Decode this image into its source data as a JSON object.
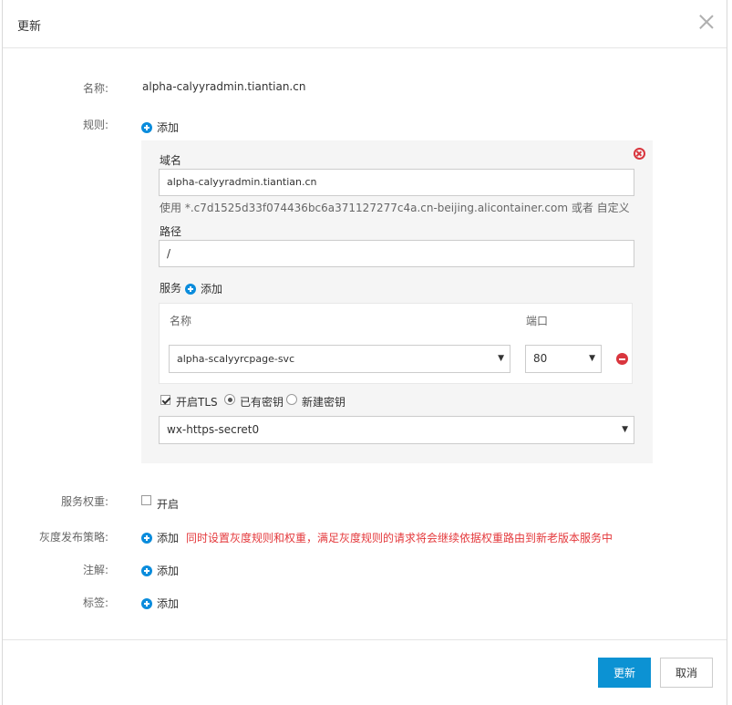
{
  "dialog": {
    "title": "更新",
    "name_label": "名称:",
    "name_value": "alpha-calyyradmin.tiantian.cn",
    "rules_label": "规则:",
    "add_label": "添加"
  },
  "rule": {
    "domain_label": "域名",
    "domain_value": "alpha-calyyradmin.tiantian.cn",
    "domain_hint": "使用 *.c7d1525d33f074436bc6a371127277c4a.cn-beijing.alicontainer.com 或者 自定义",
    "path_label": "路径",
    "path_value": "/",
    "service_label": "服务",
    "service_add_label": "添加",
    "col_name": "名称",
    "col_port": "端口",
    "service_name": "alpha-scalyyrcpage-svc",
    "service_port": "80",
    "tls_label": "开启TLS",
    "existing_secret_label": "已有密钥",
    "new_secret_label": "新建密钥",
    "secret_value": "wx-https-secret0"
  },
  "weight": {
    "label": "服务权重:",
    "enable_label": "开启"
  },
  "canary": {
    "label": "灰度发布策略:",
    "add_label": "添加",
    "warning": "同时设置灰度规则和权重，满足灰度规则的请求将会继续依据权重路由到新老版本服务中"
  },
  "annotations": {
    "label": "注解:",
    "add_label": "添加"
  },
  "tags": {
    "label": "标签:",
    "add_label": "添加"
  },
  "footer": {
    "update_label": "更新",
    "cancel_label": "取消"
  },
  "colors": {
    "primary": "#0c92d3",
    "accent_icon": "#0a8cdc",
    "danger": "#d9363e",
    "warning_text": "#e4393c"
  }
}
